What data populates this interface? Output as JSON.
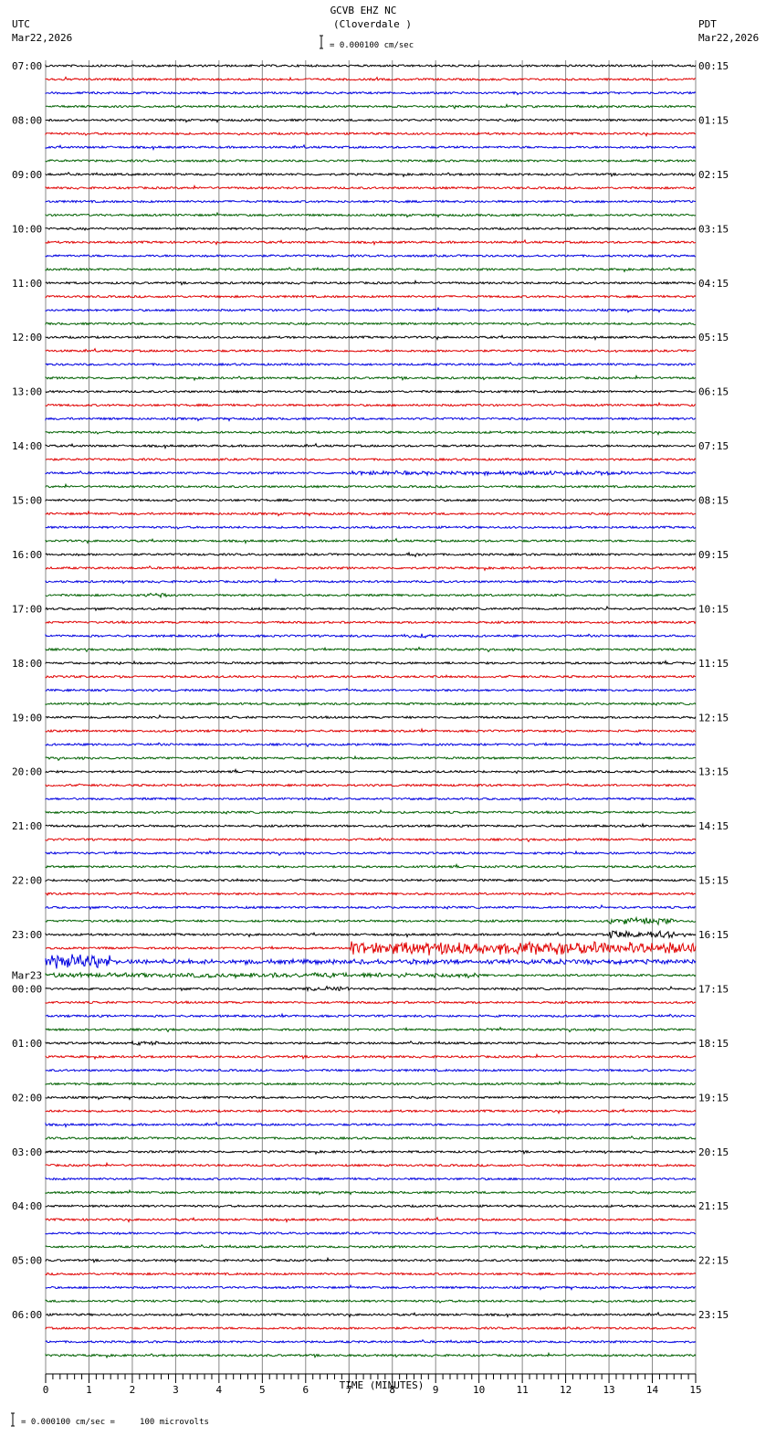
{
  "header": {
    "station": "GCVB EHZ NC",
    "location": "(Cloverdale )",
    "left_tz": "UTC",
    "left_date": "Mar22,2026",
    "right_tz": "PDT",
    "right_date": "Mar22,2026",
    "scale_text": "= 0.000100 cm/sec"
  },
  "footer": {
    "scale_text": "= 0.000100 cm/sec =     100 microvolts"
  },
  "chart_data": {
    "type": "line",
    "title": "GCVB EHZ NC (Cloverdale )",
    "xlabel": "TIME (MINUTES)",
    "xlim": [
      0,
      15
    ],
    "x_ticks": [
      "0",
      "1",
      "2",
      "3",
      "4",
      "5",
      "6",
      "7",
      "8",
      "9",
      "10",
      "11",
      "12",
      "13",
      "14",
      "15"
    ],
    "traces_per_hour": 4,
    "trace_colors": [
      "#000000",
      "#e00000",
      "#0000e0",
      "#006000"
    ],
    "left_labels": [
      "07:00",
      "08:00",
      "09:00",
      "10:00",
      "11:00",
      "12:00",
      "13:00",
      "14:00",
      "15:00",
      "16:00",
      "17:00",
      "18:00",
      "19:00",
      "20:00",
      "21:00",
      "22:00",
      "23:00",
      "00:00",
      "01:00",
      "02:00",
      "03:00",
      "04:00",
      "05:00",
      "06:00"
    ],
    "date_change_label": "Mar23",
    "right_labels": [
      "00:15",
      "01:15",
      "02:15",
      "03:15",
      "04:15",
      "05:15",
      "06:15",
      "07:15",
      "08:15",
      "09:15",
      "10:15",
      "11:15",
      "12:15",
      "13:15",
      "14:15",
      "15:15",
      "16:15",
      "17:15",
      "18:15",
      "19:15",
      "20:15",
      "21:15",
      "22:15",
      "23:15"
    ],
    "events": [
      {
        "trace": 65,
        "start_min": 7,
        "end_min": 15,
        "amplitude": 8
      },
      {
        "trace": 66,
        "start_min": 0,
        "end_min": 1.5,
        "amplitude": 9
      },
      {
        "trace": 66,
        "start_min": 1.5,
        "end_min": 15,
        "amplitude": 3
      },
      {
        "trace": 67,
        "start_min": 0,
        "end_min": 10,
        "amplitude": 3
      },
      {
        "trace": 64,
        "start_min": 13,
        "end_min": 14.5,
        "amplitude": 5
      },
      {
        "trace": 63,
        "start_min": 13,
        "end_min": 14.5,
        "amplitude": 4
      },
      {
        "trace": 30,
        "start_min": 7,
        "end_min": 13.5,
        "amplitude": 2.5
      },
      {
        "trace": 36,
        "start_min": 8.3,
        "end_min": 8.8,
        "amplitude": 3
      },
      {
        "trace": 39,
        "start_min": 2.3,
        "end_min": 2.8,
        "amplitude": 3
      },
      {
        "trace": 42,
        "start_min": 8.2,
        "end_min": 9,
        "amplitude": 2.5
      },
      {
        "trace": 68,
        "start_min": 6,
        "end_min": 7,
        "amplitude": 3
      },
      {
        "trace": 72,
        "start_min": 2,
        "end_min": 2.6,
        "amplitude": 3
      }
    ]
  }
}
